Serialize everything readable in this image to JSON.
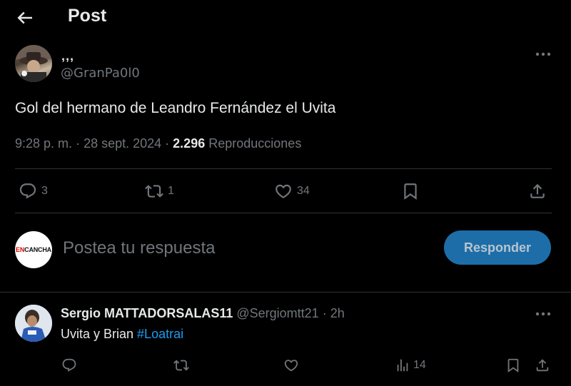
{
  "header": {
    "title": "Post",
    "back_icon": "arrow-left-icon"
  },
  "post": {
    "author_name": "‚‚‚",
    "author_handle": "@GranPa0l0",
    "text": "Gol del hermano de Leandro Fernández el Uvita",
    "time": "9:28 p. m.",
    "date": "28 sept. 2024",
    "views_count": "2.296",
    "views_label": "Reproducciones",
    "actions": {
      "replies": "3",
      "reposts": "1",
      "likes": "34"
    }
  },
  "composer": {
    "avatar_text_red": "EN",
    "avatar_text_black": "CANCHA",
    "placeholder": "Postea tu respuesta",
    "button_label": "Responder"
  },
  "reply": {
    "name": "Sergio MATTADORSALAS11",
    "handle": "@Sergiomtt21",
    "separator": "·",
    "age": "2h",
    "text_prefix": "Uvita y Brian ",
    "hashtag": "#Loatrai",
    "views": "14"
  },
  "colors": {
    "accent": "#1d9bf0",
    "button_bg": "#1d6ea8",
    "muted": "#71767b",
    "text": "#e7e9ea",
    "divider": "#2f3336"
  }
}
